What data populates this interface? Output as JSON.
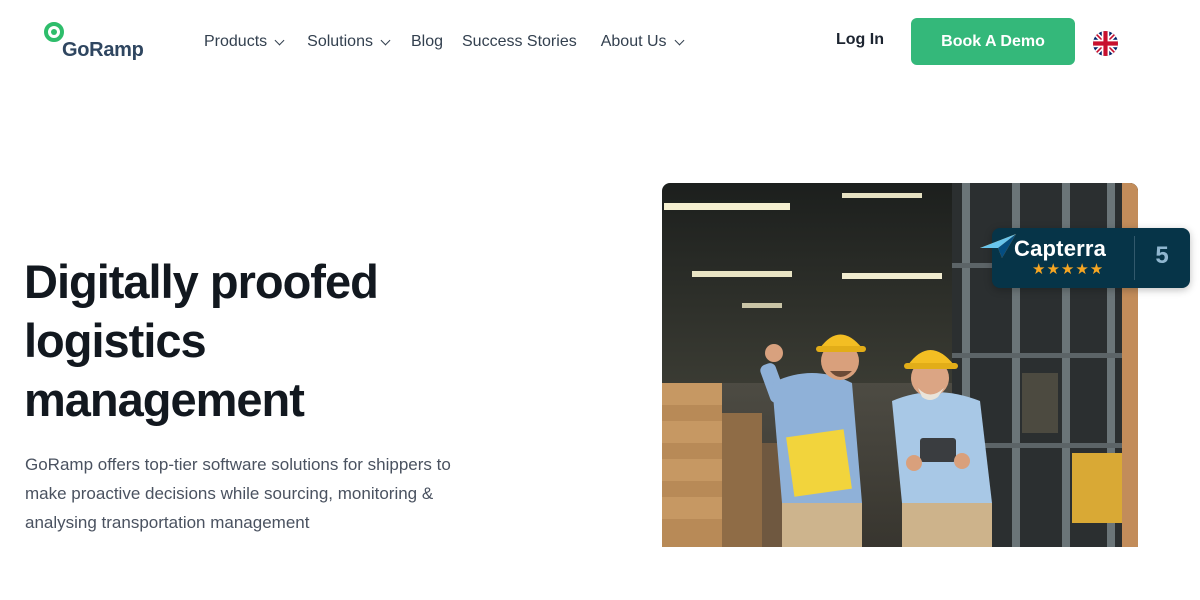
{
  "brand": {
    "name": "GoRamp",
    "accent_color": "#2ebd6b"
  },
  "nav": {
    "items": [
      {
        "label": "Products",
        "has_dropdown": true
      },
      {
        "label": "Solutions",
        "has_dropdown": true
      },
      {
        "label": "Blog",
        "has_dropdown": false
      },
      {
        "label": "Success Stories",
        "has_dropdown": false
      },
      {
        "label": "About Us",
        "has_dropdown": true
      }
    ],
    "login_label": "Log In",
    "demo_label": "Book A Demo",
    "demo_color": "#34b87a",
    "language_icon": "uk-flag-icon"
  },
  "hero": {
    "title_lines": [
      "Digitally proofed",
      "logistics",
      "management"
    ],
    "description_lines": [
      "GoRamp offers top-tier software solutions for shippers to",
      "make proactive decisions while sourcing, monitoring &",
      "analysing transportation management"
    ]
  },
  "capterra": {
    "name": "Capterra",
    "stars": "★★★★★",
    "rating": 5,
    "rating_label": "5",
    "star_color": "#f6a623",
    "badge_color": "#063448"
  }
}
